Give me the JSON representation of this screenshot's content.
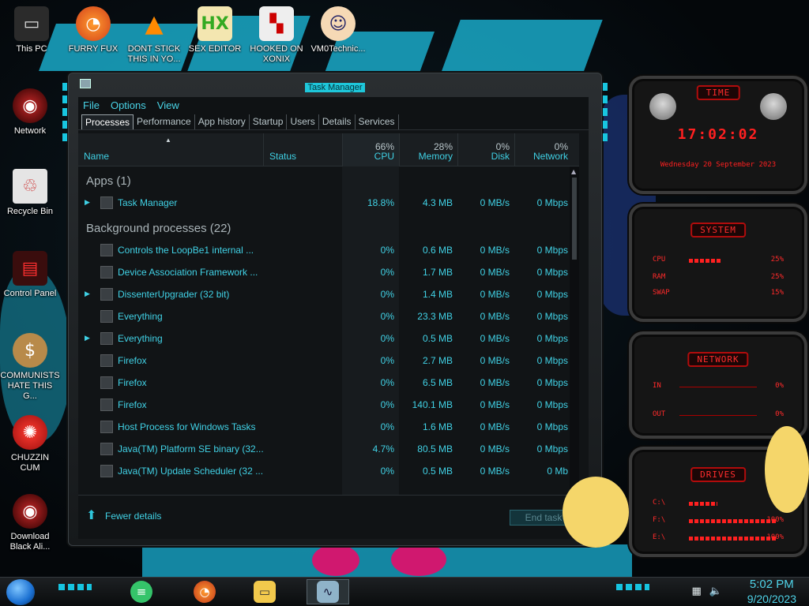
{
  "desktop": {
    "icons": [
      {
        "label": "This PC",
        "icon": "computer-icon"
      },
      {
        "label": "FURRY FUX",
        "icon": "firefox-icon"
      },
      {
        "label": "DONT STICK THIS IN YO...",
        "icon": "vlc-cone-icon"
      },
      {
        "label": "SEX EDITOR",
        "icon": "hex-editor-icon"
      },
      {
        "label": "HOOKED ON XONIX",
        "icon": "game-icon"
      },
      {
        "label": "VM0Technic...",
        "icon": "doctor-icon"
      },
      {
        "label": "Network",
        "icon": "network-icon"
      },
      {
        "label": "Recycle Bin",
        "icon": "recycle-bin-icon"
      },
      {
        "label": "Control Panel",
        "icon": "control-panel-icon"
      },
      {
        "label": "COMMUNISTS HATE THIS G...",
        "icon": "money-bag-icon"
      },
      {
        "label": "CHUZZIN CUM",
        "icon": "chuzzle-icon"
      },
      {
        "label": "Download Black Ali...",
        "icon": "alienware-icon"
      }
    ]
  },
  "task_manager": {
    "title": "Task Manager",
    "menu": [
      "File",
      "Options",
      "View"
    ],
    "tabs": [
      "Processes",
      "Performance",
      "App history",
      "Startup",
      "Users",
      "Details",
      "Services"
    ],
    "active_tab": "Processes",
    "columns": {
      "name": "Name",
      "status": "Status",
      "cpu": {
        "pct": "66%",
        "label": "CPU"
      },
      "memory": {
        "pct": "28%",
        "label": "Memory"
      },
      "disk": {
        "pct": "0%",
        "label": "Disk"
      },
      "network": {
        "pct": "0%",
        "label": "Network"
      }
    },
    "groups": {
      "apps": {
        "title": "Apps (1)"
      },
      "background": {
        "title": "Background processes (22)"
      }
    },
    "apps_rows": [
      {
        "name": "Task Manager",
        "cpu": "18.8%",
        "memory": "4.3 MB",
        "disk": "0 MB/s",
        "network": "0 Mbps",
        "expandable": true
      }
    ],
    "bg_rows": [
      {
        "name": "Controls the LoopBe1 internal ...",
        "cpu": "0%",
        "memory": "0.6 MB",
        "disk": "0 MB/s",
        "network": "0 Mbps",
        "expandable": false
      },
      {
        "name": "Device Association Framework ...",
        "cpu": "0%",
        "memory": "1.7 MB",
        "disk": "0 MB/s",
        "network": "0 Mbps",
        "expandable": false
      },
      {
        "name": "DissenterUpgrader (32 bit)",
        "cpu": "0%",
        "memory": "1.4 MB",
        "disk": "0 MB/s",
        "network": "0 Mbps",
        "expandable": true
      },
      {
        "name": "Everything",
        "cpu": "0%",
        "memory": "23.3 MB",
        "disk": "0 MB/s",
        "network": "0 Mbps",
        "expandable": false
      },
      {
        "name": "Everything",
        "cpu": "0%",
        "memory": "0.5 MB",
        "disk": "0 MB/s",
        "network": "0 Mbps",
        "expandable": true
      },
      {
        "name": "Firefox",
        "cpu": "0%",
        "memory": "2.7 MB",
        "disk": "0 MB/s",
        "network": "0 Mbps",
        "expandable": false
      },
      {
        "name": "Firefox",
        "cpu": "0%",
        "memory": "6.5 MB",
        "disk": "0 MB/s",
        "network": "0 Mbps",
        "expandable": false
      },
      {
        "name": "Firefox",
        "cpu": "0%",
        "memory": "140.1 MB",
        "disk": "0 MB/s",
        "network": "0 Mbps",
        "expandable": false
      },
      {
        "name": "Host Process for Windows Tasks",
        "cpu": "0%",
        "memory": "1.6 MB",
        "disk": "0 MB/s",
        "network": "0 Mbps",
        "expandable": false
      },
      {
        "name": "Java(TM) Platform SE binary (32...",
        "cpu": "4.7%",
        "memory": "80.5 MB",
        "disk": "0 MB/s",
        "network": "0 Mbps",
        "expandable": false
      },
      {
        "name": "Java(TM) Update Scheduler (32 ...",
        "cpu": "0%",
        "memory": "0.5 MB",
        "disk": "0 MB/s",
        "network": "0 Mb",
        "expandable": false
      }
    ],
    "footer": {
      "fewer_details": "Fewer details",
      "end_task": "End task"
    }
  },
  "gadgets": {
    "time": {
      "header": "TIME",
      "clock": "17:02:02",
      "date": "Wednesday 20 September 2023"
    },
    "system": {
      "header": "SYSTEM",
      "rows": [
        {
          "label": "CPU",
          "value": "25%"
        },
        {
          "label": "RAM",
          "value": "25%"
        },
        {
          "label": "SWAP",
          "value": "15%"
        }
      ]
    },
    "network": {
      "header": "NETWORK",
      "rows": [
        {
          "label": "IN",
          "value": "0%"
        },
        {
          "label": "OUT",
          "value": "0%"
        }
      ]
    },
    "drives": {
      "header": "DRIVES",
      "rows": [
        {
          "label": "C:\\",
          "value": ""
        },
        {
          "label": "F:\\",
          "value": "100%"
        },
        {
          "label": "E:\\",
          "value": "100%"
        }
      ]
    }
  },
  "taskbar": {
    "apps": [
      {
        "icon": "notes-icon",
        "color": "#35c46a"
      },
      {
        "icon": "firefox-icon",
        "color": "#ff7a1a"
      },
      {
        "icon": "file-explorer-icon",
        "color": "#f2c94c"
      },
      {
        "icon": "task-manager-icon",
        "color": "#8fb3c9"
      }
    ],
    "clock": {
      "time": "5:02 PM",
      "date": "9/20/2023"
    }
  }
}
